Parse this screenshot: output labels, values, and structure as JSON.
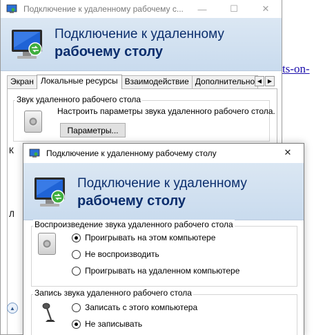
{
  "background": {
    "link_text": "ts-on-"
  },
  "back_window": {
    "title": "Подключение к удаленному рабочему с...",
    "banner_line1": "Подключение к удаленному",
    "banner_line2": "рабочему столу",
    "tabs": [
      {
        "label": "Экран"
      },
      {
        "label": "Локальные ресурсы"
      },
      {
        "label": "Взаимодействие"
      },
      {
        "label": "Дополнительно"
      }
    ],
    "active_tab": "Локальные ресурсы",
    "audio_group": {
      "title": "Звук удаленного рабочего стола",
      "description": "Настроить параметры звука удаленного рабочего стола.",
      "button_label": "Параметры..."
    },
    "partial_label_1": "К",
    "partial_label_2": "Л"
  },
  "front_window": {
    "title": "Подключение к удаленному рабочему столу",
    "close_glyph": "✕",
    "banner_line1": "Подключение к удаленному",
    "banner_line2": "рабочему столу",
    "playback_group": {
      "title": "Воспроизведение звука удаленного рабочего стола",
      "options": [
        {
          "label": "Проигрывать на этом компьютере",
          "selected": true
        },
        {
          "label": "Не воспроизводить",
          "selected": false
        },
        {
          "label": "Проигрывать на удаленном компьютере",
          "selected": false
        }
      ]
    },
    "recording_group": {
      "title": "Запись звука удаленного рабочего стола",
      "options": [
        {
          "label": "Записать с этого компьютера",
          "selected": false
        },
        {
          "label": "Не записывать",
          "selected": true
        }
      ]
    }
  },
  "colors": {
    "banner_text": "#0b2e6d",
    "banner_bg": "#c9dbee",
    "link": "#1a0dab"
  }
}
